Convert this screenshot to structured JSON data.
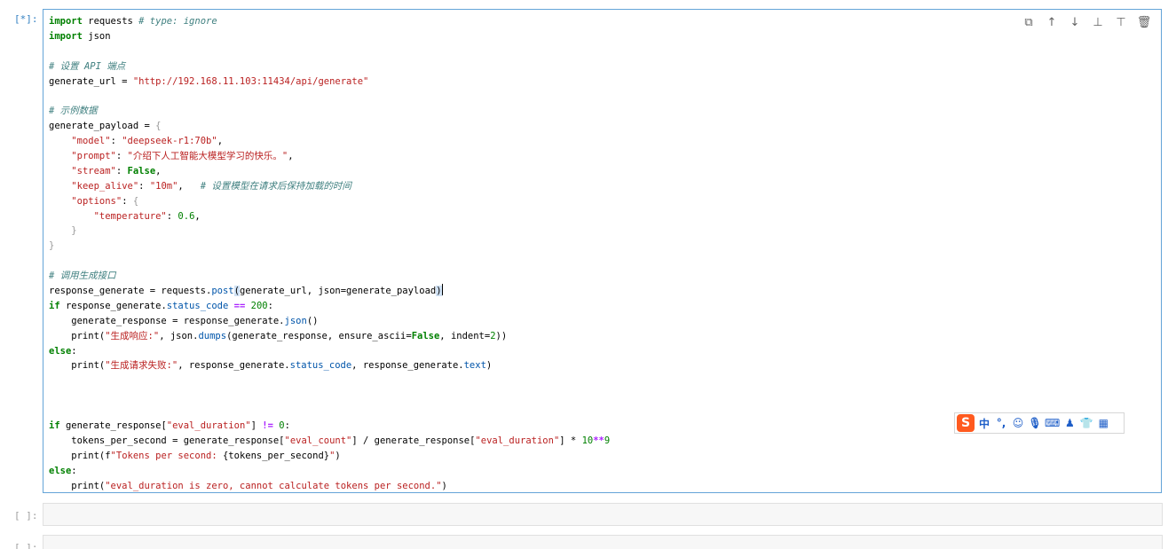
{
  "cells": [
    {
      "prompt": "[*]:"
    },
    {
      "prompt": "[ ]:"
    },
    {
      "prompt": "[ ]:"
    }
  ],
  "code_lines": [
    [
      {
        "t": "import",
        "c": "kw"
      },
      {
        "t": " requests ",
        "c": "txt"
      },
      {
        "t": "# type: ignore",
        "c": "cm"
      }
    ],
    [
      {
        "t": "import",
        "c": "kw"
      },
      {
        "t": " json",
        "c": "txt"
      }
    ],
    [],
    [
      {
        "t": "# 设置 API 端点",
        "c": "cm"
      }
    ],
    [
      {
        "t": "generate_url = ",
        "c": "txt"
      },
      {
        "t": "\"http://192.168.11.103:11434/api/generate\"",
        "c": "str"
      }
    ],
    [],
    [
      {
        "t": "# 示例数据",
        "c": "cm"
      }
    ],
    [
      {
        "t": "generate_payload = ",
        "c": "txt"
      },
      {
        "t": "{",
        "c": "brk"
      }
    ],
    [
      {
        "t": "    ",
        "c": "txt"
      },
      {
        "t": "\"model\"",
        "c": "str"
      },
      {
        "t": ": ",
        "c": "txt"
      },
      {
        "t": "\"deepseek-r1:70b\"",
        "c": "str"
      },
      {
        "t": ",",
        "c": "txt"
      }
    ],
    [
      {
        "t": "    ",
        "c": "txt"
      },
      {
        "t": "\"prompt\"",
        "c": "str"
      },
      {
        "t": ": ",
        "c": "txt"
      },
      {
        "t": "\"介绍下人工智能大模型学习的快乐。\"",
        "c": "str"
      },
      {
        "t": ",",
        "c": "txt"
      }
    ],
    [
      {
        "t": "    ",
        "c": "txt"
      },
      {
        "t": "\"stream\"",
        "c": "str"
      },
      {
        "t": ": ",
        "c": "txt"
      },
      {
        "t": "False",
        "c": "kw"
      },
      {
        "t": ",",
        "c": "txt"
      }
    ],
    [
      {
        "t": "    ",
        "c": "txt"
      },
      {
        "t": "\"keep_alive\"",
        "c": "str"
      },
      {
        "t": ": ",
        "c": "txt"
      },
      {
        "t": "\"10m\"",
        "c": "str"
      },
      {
        "t": ",   ",
        "c": "txt"
      },
      {
        "t": "# 设置模型在请求后保持加载的时间",
        "c": "cm"
      }
    ],
    [
      {
        "t": "    ",
        "c": "txt"
      },
      {
        "t": "\"options\"",
        "c": "str"
      },
      {
        "t": ": ",
        "c": "txt"
      },
      {
        "t": "{",
        "c": "brk"
      }
    ],
    [
      {
        "t": "        ",
        "c": "txt"
      },
      {
        "t": "\"temperature\"",
        "c": "str"
      },
      {
        "t": ": ",
        "c": "txt"
      },
      {
        "t": "0.6",
        "c": "num"
      },
      {
        "t": ",",
        "c": "txt"
      }
    ],
    [
      {
        "t": "    ",
        "c": "txt"
      },
      {
        "t": "}",
        "c": "brk"
      }
    ],
    [
      {
        "t": "}",
        "c": "brk"
      }
    ],
    [],
    [
      {
        "t": "# 调用生成接口",
        "c": "cm"
      }
    ],
    [
      {
        "t": "response_generate = requests.",
        "c": "txt"
      },
      {
        "t": "post",
        "c": "attr"
      },
      {
        "t": "(",
        "c": "mb"
      },
      {
        "t": "generate_url, json=generate_payload",
        "c": "txt"
      },
      {
        "t": ")",
        "c": "mb"
      },
      {
        "t": "",
        "c": "cursor"
      }
    ],
    [
      {
        "t": "if",
        "c": "kw"
      },
      {
        "t": " response_generate.",
        "c": "txt"
      },
      {
        "t": "status_code",
        "c": "attr"
      },
      {
        "t": " ",
        "c": "txt"
      },
      {
        "t": "==",
        "c": "op"
      },
      {
        "t": " ",
        "c": "txt"
      },
      {
        "t": "200",
        "c": "num"
      },
      {
        "t": ":",
        "c": "txt"
      }
    ],
    [
      {
        "t": "    generate_response = response_generate.",
        "c": "txt"
      },
      {
        "t": "json",
        "c": "attr"
      },
      {
        "t": "()",
        "c": "txt"
      }
    ],
    [
      {
        "t": "    print(",
        "c": "txt"
      },
      {
        "t": "\"生成响应:\"",
        "c": "str"
      },
      {
        "t": ", json.",
        "c": "txt"
      },
      {
        "t": "dumps",
        "c": "attr"
      },
      {
        "t": "(generate_response, ensure_ascii=",
        "c": "txt"
      },
      {
        "t": "False",
        "c": "kw"
      },
      {
        "t": ", indent=",
        "c": "txt"
      },
      {
        "t": "2",
        "c": "num"
      },
      {
        "t": "))",
        "c": "txt"
      }
    ],
    [
      {
        "t": "else",
        "c": "kw"
      },
      {
        "t": ":",
        "c": "txt"
      }
    ],
    [
      {
        "t": "    print(",
        "c": "txt"
      },
      {
        "t": "\"生成请求失败:\"",
        "c": "str"
      },
      {
        "t": ", response_generate.",
        "c": "txt"
      },
      {
        "t": "status_code",
        "c": "attr"
      },
      {
        "t": ", response_generate.",
        "c": "txt"
      },
      {
        "t": "text",
        "c": "attr"
      },
      {
        "t": ")",
        "c": "txt"
      }
    ],
    [],
    [],
    [],
    [
      {
        "t": "if",
        "c": "kw"
      },
      {
        "t": " generate_response[",
        "c": "txt"
      },
      {
        "t": "\"eval_duration\"",
        "c": "str"
      },
      {
        "t": "] ",
        "c": "txt"
      },
      {
        "t": "!=",
        "c": "op"
      },
      {
        "t": " ",
        "c": "txt"
      },
      {
        "t": "0",
        "c": "num"
      },
      {
        "t": ":",
        "c": "txt"
      }
    ],
    [
      {
        "t": "    tokens_per_second = generate_response[",
        "c": "txt"
      },
      {
        "t": "\"eval_count\"",
        "c": "str"
      },
      {
        "t": "] / generate_response[",
        "c": "txt"
      },
      {
        "t": "\"eval_duration\"",
        "c": "str"
      },
      {
        "t": "] * ",
        "c": "txt"
      },
      {
        "t": "10",
        "c": "num"
      },
      {
        "t": "**",
        "c": "op"
      },
      {
        "t": "9",
        "c": "num"
      }
    ],
    [
      {
        "t": "    print(f",
        "c": "txt"
      },
      {
        "t": "\"Tokens per second: ",
        "c": "str"
      },
      {
        "t": "{tokens_per_second}",
        "c": "txt"
      },
      {
        "t": "\"",
        "c": "str"
      },
      {
        "t": ")",
        "c": "txt"
      }
    ],
    [
      {
        "t": "else",
        "c": "kw"
      },
      {
        "t": ":",
        "c": "txt"
      }
    ],
    [
      {
        "t": "    print(",
        "c": "txt"
      },
      {
        "t": "\"eval_duration is zero, cannot calculate tokens per second.\"",
        "c": "str"
      },
      {
        "t": ")",
        "c": "txt"
      }
    ]
  ],
  "toolbar": {
    "copy": "⧉",
    "move_up": "↑",
    "move_down": "↓",
    "insert_above": "⊥",
    "insert_below": "⊤",
    "delete": "🗑"
  },
  "ime": {
    "logo": "S",
    "mode": "中",
    "punct": "°,",
    "emoji": "☺",
    "voice": "🎙",
    "keyboard": "⌨",
    "skin": "♟",
    "shirt": "👕",
    "grid": "▦"
  },
  "colors": {
    "active_border": "#64a4d8",
    "keyword": "#008000",
    "string": "#ba2121",
    "comment": "#408080"
  }
}
